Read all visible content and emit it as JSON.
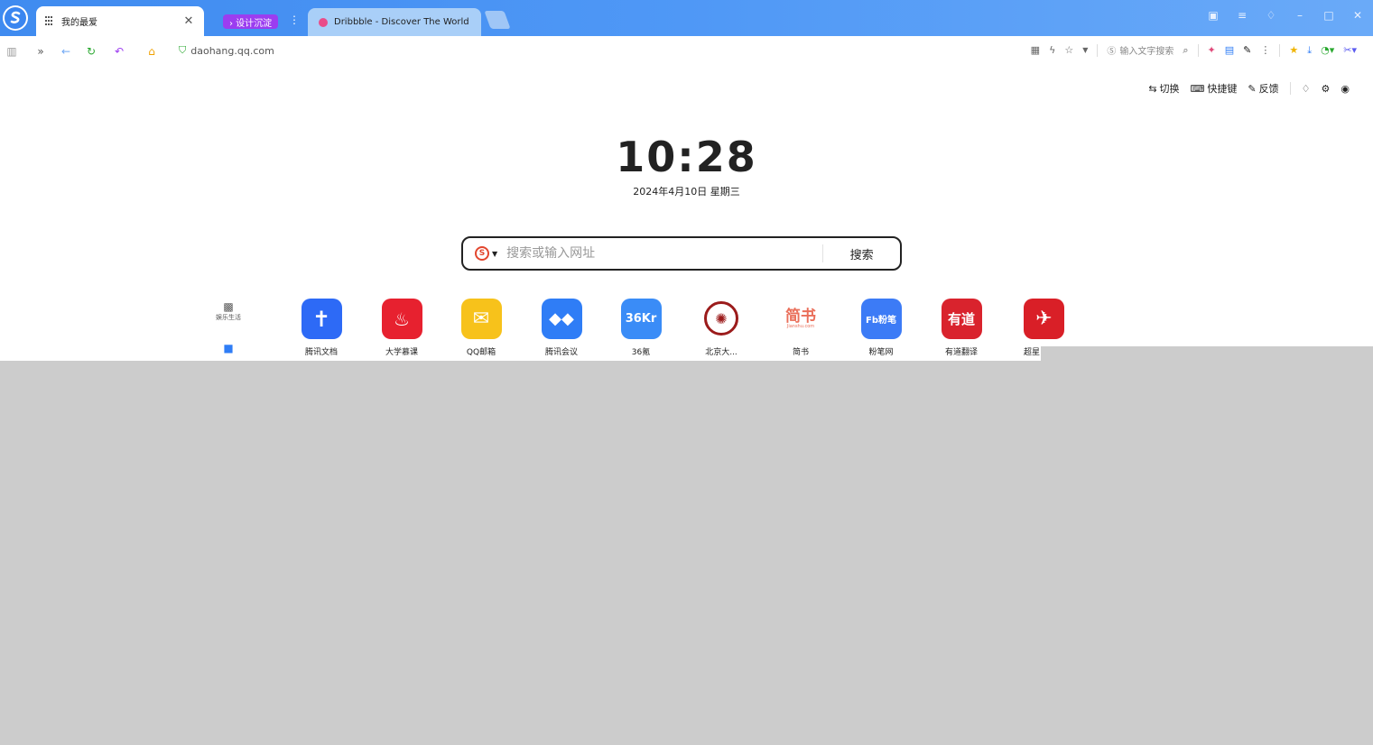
{
  "tabs": {
    "active_title": "我的最爱",
    "group_label": "› 设计沉淀",
    "dribbble_title": "Dribbble - Discover The World"
  },
  "address": {
    "url": "daohang.qq.com",
    "inline_search_placeholder": "输入文字搜索"
  },
  "page": {
    "actions": {
      "switch": "切换",
      "shortcuts": "快捷键",
      "feedback": "反馈"
    },
    "time": "10:28",
    "date": "2024年4月10日  星期三",
    "search": {
      "placeholder": "搜索或输入网址",
      "button": "搜索"
    },
    "side_categories": [
      {
        "label": "娱乐生活"
      },
      {
        "label": ""
      }
    ],
    "apps": [
      {
        "label": "腾讯文档",
        "color": "#2d6af6"
      },
      {
        "label": "大学慕课",
        "color": "#e7212f"
      },
      {
        "label": "QQ邮箱",
        "color": "#f7c21b"
      },
      {
        "label": "腾讯会议",
        "color": "#2f7df6"
      },
      {
        "label": "36氪",
        "color": "#3a8cf7",
        "glyph": "36Kr"
      },
      {
        "label": "北京大...",
        "color": "#9b1b1b"
      },
      {
        "label": "简书",
        "color": "#ea6f5a",
        "glyph": "简书",
        "sub": "Jianshu.com"
      },
      {
        "label": "粉笔网",
        "color": "#3c7bf6",
        "glyph": "Fb粉笔"
      },
      {
        "label": "有道翻译",
        "color": "#d9232d",
        "glyph": "有道"
      },
      {
        "label": "超星",
        "color": "#d91f27"
      }
    ]
  }
}
